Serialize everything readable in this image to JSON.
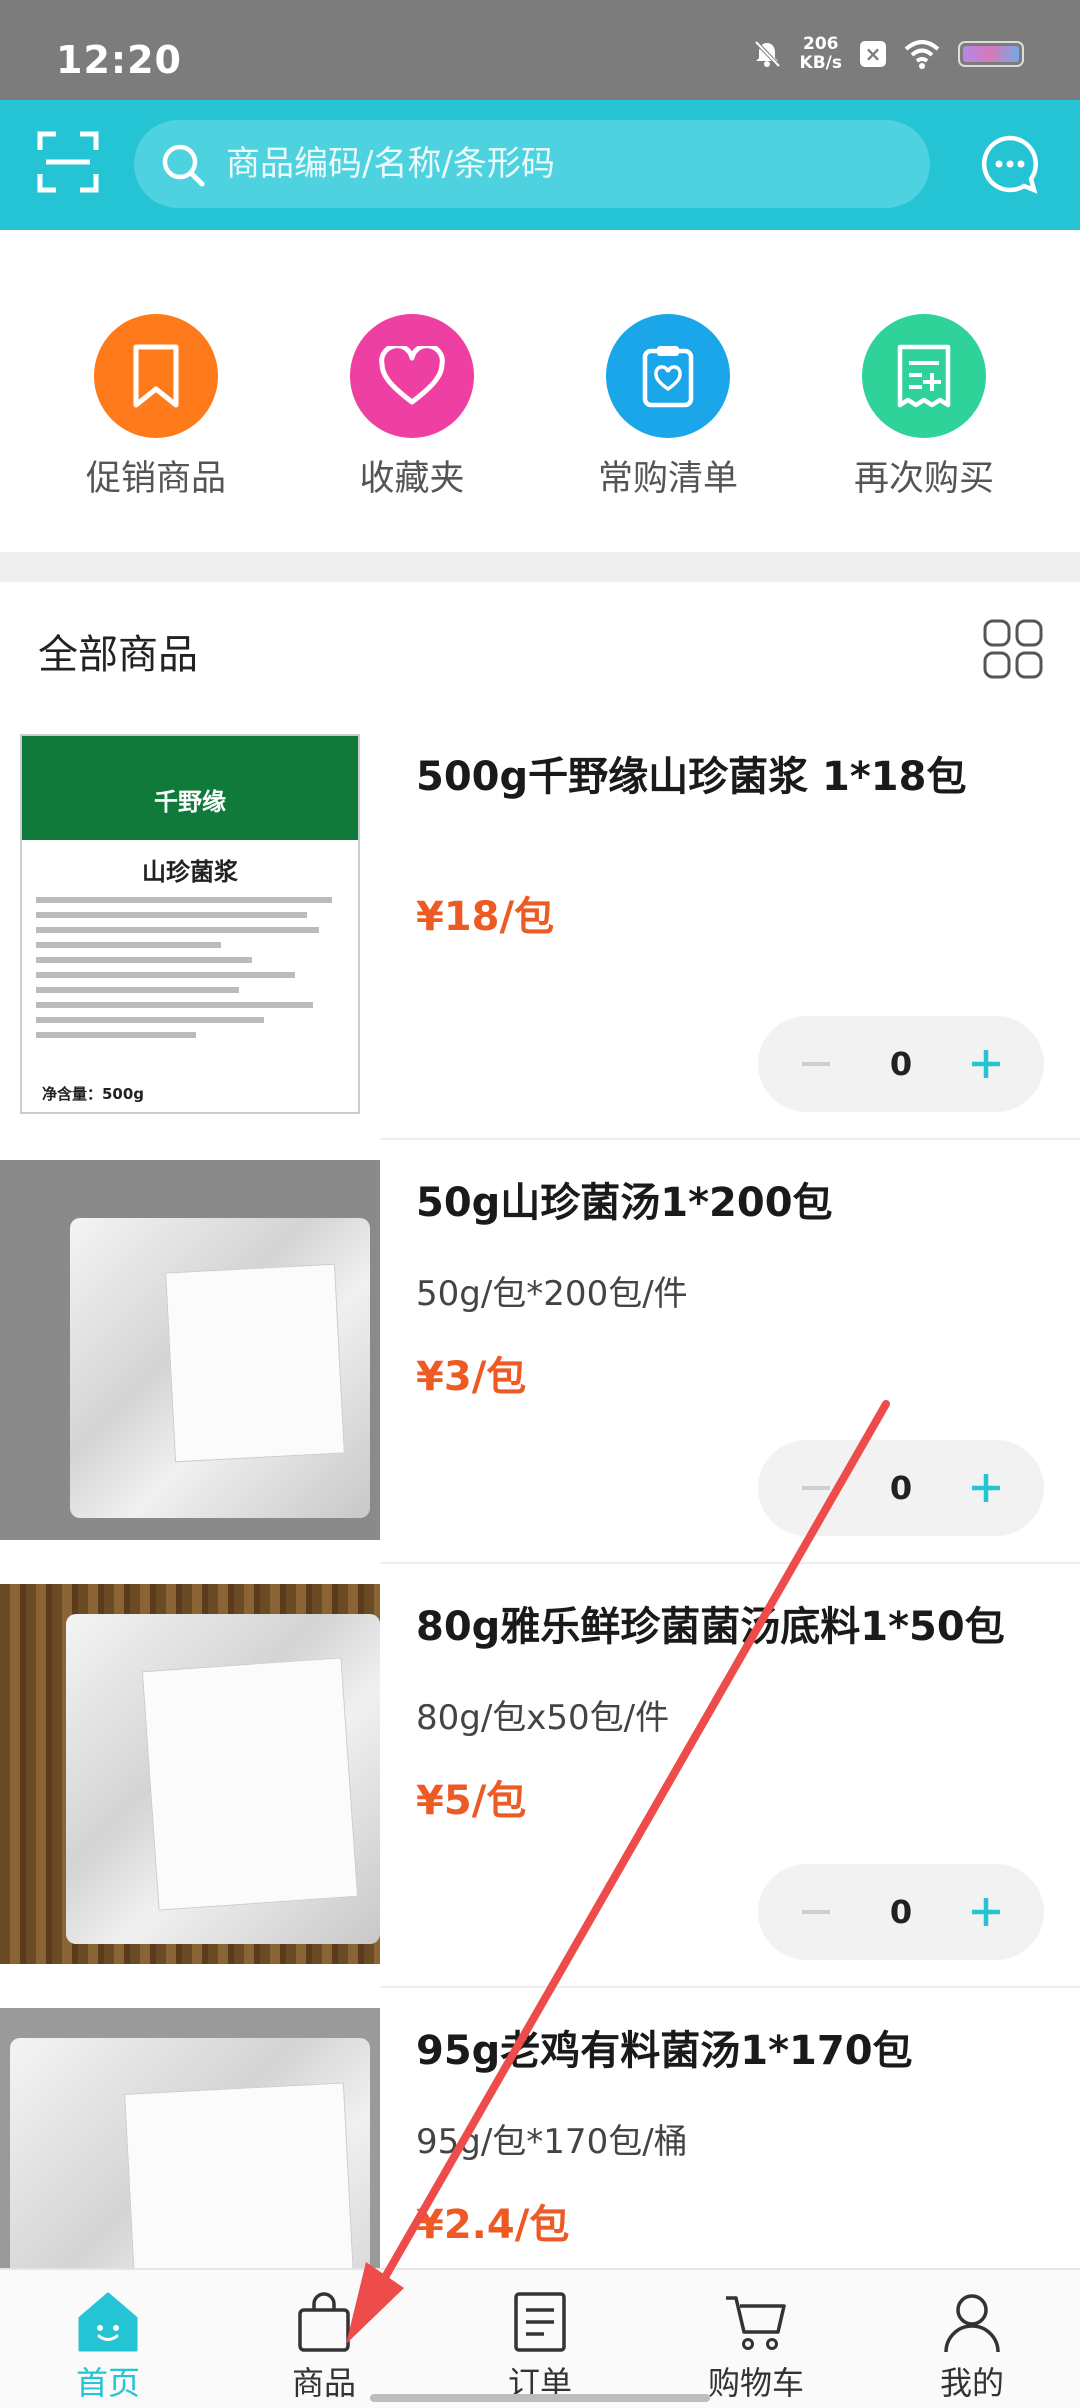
{
  "status_bar": {
    "time": "12:20",
    "net_speed_value": "206",
    "net_speed_unit": "KB/s"
  },
  "header": {
    "search_placeholder": "商品编码/名称/条形码"
  },
  "quick_entries": [
    {
      "label": "促销商品",
      "icon": "bookmark-icon",
      "color": "#ff7a1a"
    },
    {
      "label": "收藏夹",
      "icon": "heart-icon",
      "color": "#ee3fa2"
    },
    {
      "label": "常购清单",
      "icon": "clipboard-heart-icon",
      "color": "#1ba6ea"
    },
    {
      "label": "再次购买",
      "icon": "receipt-plus-icon",
      "color": "#2fd39a"
    }
  ],
  "list": {
    "title": "全部商品"
  },
  "products": [
    {
      "name": "500g千野缘山珍菌浆 1*18包",
      "spec": "",
      "price_symbol": "¥",
      "price_value": "18",
      "price_unit": "/包",
      "quantity": "0",
      "thumb": {
        "brand": "千野缘",
        "product": "山珍菌浆",
        "net": "净含量：500g"
      }
    },
    {
      "name": "50g山珍菌汤1*200包",
      "spec": "50g/包*200包/件",
      "price_symbol": "¥",
      "price_value": "3",
      "price_unit": "/包",
      "quantity": "0"
    },
    {
      "name": "80g雅乐鲜珍菌菌汤底料1*50包",
      "spec": "80g/包x50包/件",
      "price_symbol": "¥",
      "price_value": "5",
      "price_unit": "/包",
      "quantity": "0"
    },
    {
      "name": "95g老鸡有料菌汤1*170包",
      "spec": "95g/包*170包/桶",
      "price_symbol": "¥",
      "price_value": "2.4",
      "price_unit": "/包",
      "quantity": ""
    }
  ],
  "bottom_nav": [
    {
      "label": "首页",
      "icon": "home-icon",
      "active": true
    },
    {
      "label": "商品",
      "icon": "bag-icon",
      "active": false
    },
    {
      "label": "订单",
      "icon": "order-list-icon",
      "active": false
    },
    {
      "label": "购物车",
      "icon": "cart-icon",
      "active": false
    },
    {
      "label": "我的",
      "icon": "user-icon",
      "active": false
    }
  ],
  "colors": {
    "brand": "#25c4d4",
    "price": "#ee5a24",
    "annotation_arrow": "#ee4b4b"
  }
}
